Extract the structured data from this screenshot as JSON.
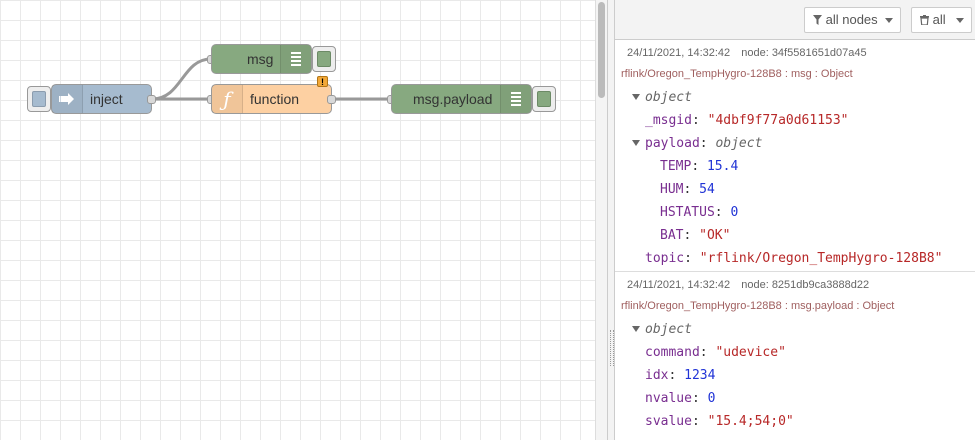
{
  "workspace": {
    "nodes": {
      "inject": {
        "label": "inject",
        "color": "#a6bbcf"
      },
      "msg_debug": {
        "label": "msg",
        "color": "#87a980"
      },
      "function": {
        "label": "function",
        "color": "#fdd0a2",
        "icon_glyph": "ƒ",
        "warning": "!"
      },
      "payload_debug": {
        "label": "msg.payload",
        "color": "#87a980"
      }
    }
  },
  "sidebar": {
    "filter_nodes": {
      "icon": "filter-icon",
      "label": "all nodes"
    },
    "clear": {
      "icon": "trash-icon",
      "label": "all"
    },
    "messages": [
      {
        "timestamp": "24/11/2021, 14:32:42",
        "node": "node: 34f5581651d07a45",
        "topic_line": "rflink/Oregon_TempHygro-128B8 : msg : Object",
        "root_type": "object",
        "msgid_key": "_msgid",
        "msgid_value": "\"4dbf9f77a0d61153\"",
        "payload_key": "payload",
        "payload_type": "object",
        "payload": [
          {
            "key": "TEMP",
            "value": "15.4",
            "kind": "num"
          },
          {
            "key": "HUM",
            "value": "54",
            "kind": "num"
          },
          {
            "key": "HSTATUS",
            "value": "0",
            "kind": "num"
          },
          {
            "key": "BAT",
            "value": "\"OK\"",
            "kind": "str"
          }
        ],
        "topic_key": "topic",
        "topic_value": "\"rflink/Oregon_TempHygro-128B8\""
      },
      {
        "timestamp": "24/11/2021, 14:32:42",
        "node": "node: 8251db9ca3888d22",
        "topic_line": "rflink/Oregon_TempHygro-128B8 : msg.payload : Object",
        "root_type": "object",
        "props": [
          {
            "key": "command",
            "value": "\"udevice\"",
            "kind": "str"
          },
          {
            "key": "idx",
            "value": "1234",
            "kind": "num"
          },
          {
            "key": "nvalue",
            "value": "0",
            "kind": "num"
          },
          {
            "key": "svalue",
            "value": "\"15.4;54;0\"",
            "kind": "str"
          }
        ]
      }
    ]
  }
}
